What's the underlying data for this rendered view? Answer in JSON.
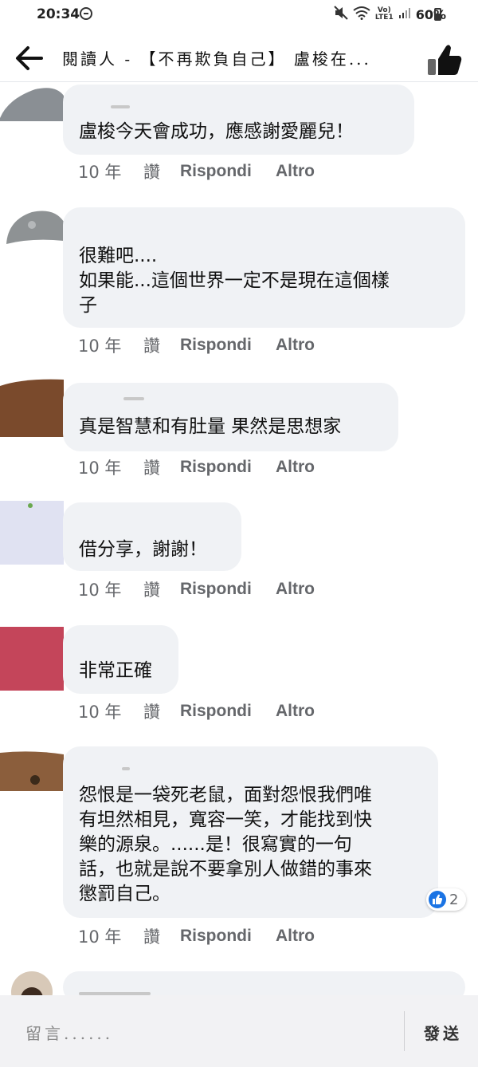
{
  "status_bar": {
    "time": "20:34",
    "network": "LTE1",
    "battery": "60%"
  },
  "header": {
    "title": "閱讀人 - 【不再欺負自己】 盧梭在..."
  },
  "comments": [
    {
      "text": "盧梭今天會成功，應感謝愛麗兒！",
      "time": "10 年",
      "like": "讚",
      "reply": "Rispondi",
      "more": "Altro"
    },
    {
      "text": "很難吧....\n如果能...這個世界一定不是現在這個樣\n子",
      "time": "10 年",
      "like": "讚",
      "reply": "Rispondi",
      "more": "Altro"
    },
    {
      "text": "真是智慧和有肚量 果然是思想家",
      "time": "10 年",
      "like": "讚",
      "reply": "Rispondi",
      "more": "Altro"
    },
    {
      "text": "借分享，謝謝！",
      "time": "10 年",
      "like": "讚",
      "reply": "Rispondi",
      "more": "Altro"
    },
    {
      "text": "非常正確",
      "time": "10 年",
      "like": "讚",
      "reply": "Rispondi",
      "more": "Altro"
    },
    {
      "text": "怨恨是一袋死老鼠，面對怨恨我們唯\n有坦然相見，寬容一笑，才能找到快\n樂的源泉。......是！很寫實的一句\n話，也就是說不要拿別人做錯的事來\n懲罰自己。",
      "time": "10 年",
      "like": "讚",
      "reply": "Rispondi",
      "more": "Altro",
      "reaction_count": "2"
    }
  ],
  "composer": {
    "placeholder": "留言......",
    "send_label": "發送"
  },
  "colors": {
    "bubble": "#f0f2f5",
    "meta_text": "#65676b",
    "like_blue": "#1b74e4"
  }
}
